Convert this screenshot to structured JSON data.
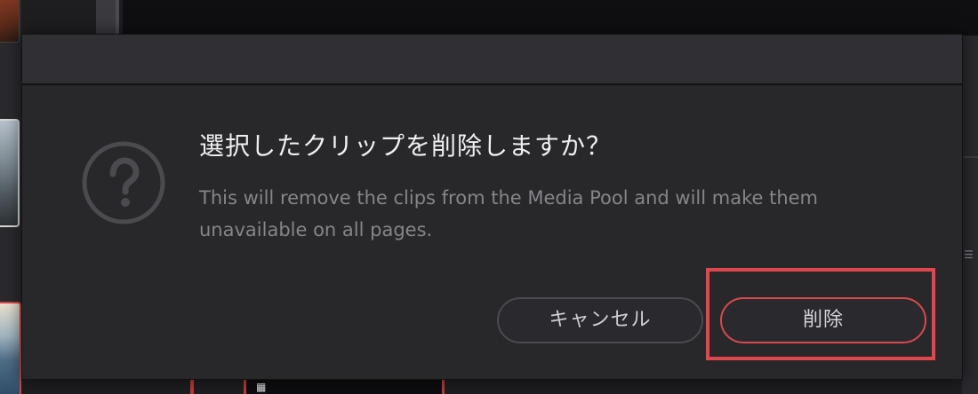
{
  "dialog": {
    "title": "選択したクリップを削除しますか？",
    "message": "This will remove the clips from the Media Pool and will make them unavailable on all pages.",
    "icon": "question-mark-circle-icon",
    "buttons": {
      "cancel_label": "キャンセル",
      "delete_label": "削除"
    }
  },
  "colors": {
    "dialog_bg": "#28282b",
    "titlebar_bg": "#303034",
    "title_text": "#f0f0f2",
    "message_text": "#85858a",
    "delete_outline": "#d84a4a",
    "highlight": "#e0474c"
  }
}
